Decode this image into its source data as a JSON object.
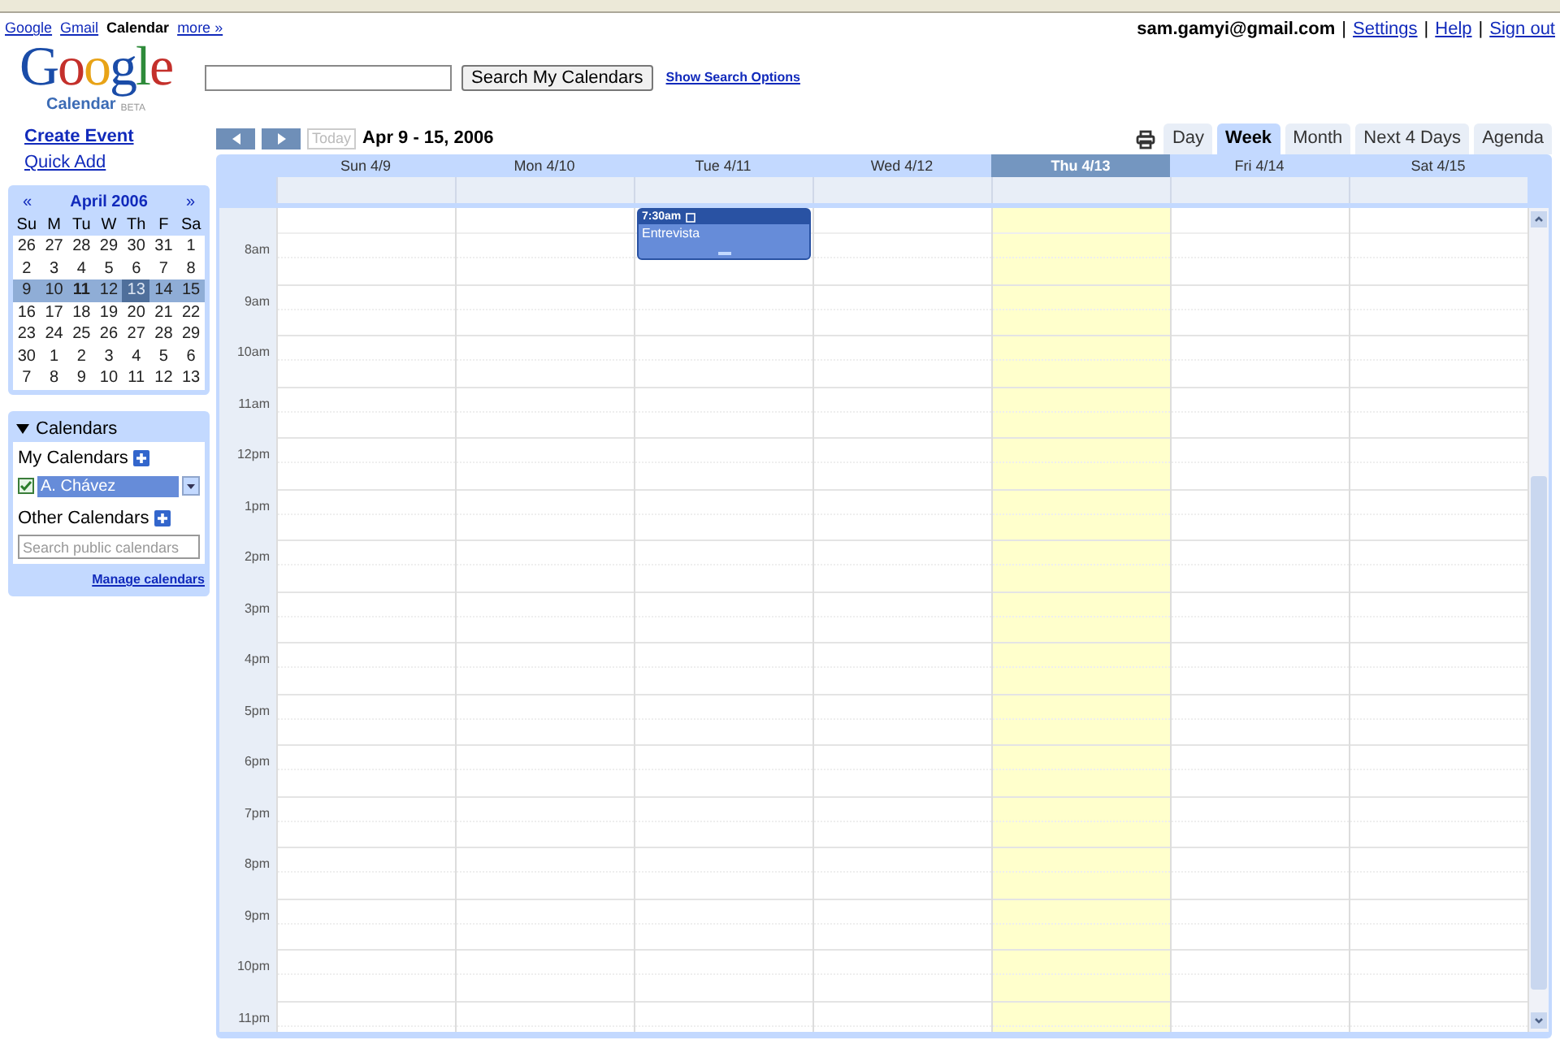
{
  "top_links": [
    {
      "label": "Google",
      "kind": "link"
    },
    {
      "label": "Gmail",
      "kind": "link"
    },
    {
      "label": "Calendar",
      "kind": "current"
    },
    {
      "label": "more »",
      "kind": "link"
    }
  ],
  "account": {
    "email": "sam.gamyi@gmail.com",
    "links": [
      {
        "separator": "|",
        "label": "Settings"
      },
      {
        "separator": "|",
        "label": "Help"
      },
      {
        "separator": "|",
        "label": "Sign out"
      }
    ]
  },
  "logo": {
    "word": "Google",
    "product": "Calendar",
    "badge": "BETA"
  },
  "search": {
    "button": "Search My Calendars",
    "options_link": "Show Search Options"
  },
  "sidebar": {
    "actions": [
      "Create Event",
      "Quick Add"
    ],
    "mini_calendar": {
      "title": "April 2006",
      "prev": "«",
      "next": "»",
      "weekdays": [
        "Su",
        "M",
        "Tu",
        "W",
        "Th",
        "F",
        "Sa"
      ],
      "weeks": [
        {
          "selected": false,
          "days": [
            {
              "label": "26",
              "today": false,
              "bold": false
            },
            {
              "label": "27",
              "today": false,
              "bold": false
            },
            {
              "label": "28",
              "today": false,
              "bold": false
            },
            {
              "label": "29",
              "today": false,
              "bold": false
            },
            {
              "label": "30",
              "today": false,
              "bold": false
            },
            {
              "label": "31",
              "today": false,
              "bold": false
            },
            {
              "label": "1",
              "today": false,
              "bold": false
            }
          ]
        },
        {
          "selected": false,
          "days": [
            {
              "label": "2",
              "today": false,
              "bold": false
            },
            {
              "label": "3",
              "today": false,
              "bold": false
            },
            {
              "label": "4",
              "today": false,
              "bold": false
            },
            {
              "label": "5",
              "today": false,
              "bold": false
            },
            {
              "label": "6",
              "today": false,
              "bold": false
            },
            {
              "label": "7",
              "today": false,
              "bold": false
            },
            {
              "label": "8",
              "today": false,
              "bold": false
            }
          ]
        },
        {
          "selected": true,
          "days": [
            {
              "label": "9",
              "today": false,
              "bold": false
            },
            {
              "label": "10",
              "today": false,
              "bold": false
            },
            {
              "label": "11",
              "today": false,
              "bold": true
            },
            {
              "label": "12",
              "today": false,
              "bold": false
            },
            {
              "label": "13",
              "today": true,
              "bold": false
            },
            {
              "label": "14",
              "today": false,
              "bold": false
            },
            {
              "label": "15",
              "today": false,
              "bold": false
            }
          ]
        },
        {
          "selected": false,
          "days": [
            {
              "label": "16",
              "today": false,
              "bold": false
            },
            {
              "label": "17",
              "today": false,
              "bold": false
            },
            {
              "label": "18",
              "today": false,
              "bold": false
            },
            {
              "label": "19",
              "today": false,
              "bold": false
            },
            {
              "label": "20",
              "today": false,
              "bold": false
            },
            {
              "label": "21",
              "today": false,
              "bold": false
            },
            {
              "label": "22",
              "today": false,
              "bold": false
            }
          ]
        },
        {
          "selected": false,
          "days": [
            {
              "label": "23",
              "today": false,
              "bold": false
            },
            {
              "label": "24",
              "today": false,
              "bold": false
            },
            {
              "label": "25",
              "today": false,
              "bold": false
            },
            {
              "label": "26",
              "today": false,
              "bold": false
            },
            {
              "label": "27",
              "today": false,
              "bold": false
            },
            {
              "label": "28",
              "today": false,
              "bold": false
            },
            {
              "label": "29",
              "today": false,
              "bold": false
            }
          ]
        },
        {
          "selected": false,
          "days": [
            {
              "label": "30",
              "today": false,
              "bold": false
            },
            {
              "label": "1",
              "today": false,
              "bold": false
            },
            {
              "label": "2",
              "today": false,
              "bold": false
            },
            {
              "label": "3",
              "today": false,
              "bold": false
            },
            {
              "label": "4",
              "today": false,
              "bold": false
            },
            {
              "label": "5",
              "today": false,
              "bold": false
            },
            {
              "label": "6",
              "today": false,
              "bold": false
            }
          ]
        },
        {
          "selected": false,
          "days": [
            {
              "label": "7",
              "today": false,
              "bold": false
            },
            {
              "label": "8",
              "today": false,
              "bold": false
            },
            {
              "label": "9",
              "today": false,
              "bold": false
            },
            {
              "label": "10",
              "today": false,
              "bold": false
            },
            {
              "label": "11",
              "today": false,
              "bold": false
            },
            {
              "label": "12",
              "today": false,
              "bold": false
            },
            {
              "label": "13",
              "today": false,
              "bold": false
            }
          ]
        }
      ]
    },
    "calendars": {
      "title": "Calendars",
      "expanded": true,
      "my_label": "My Calendars",
      "my": [
        {
          "name": "A. Chávez",
          "checked": true,
          "color": "#668cd9"
        }
      ],
      "other_label": "Other Calendars",
      "search_placeholder": "Search public calendars",
      "manage_link": "Manage calendars"
    }
  },
  "toolbar": {
    "today": "Today",
    "range": "Apr 9 - 15, 2006"
  },
  "views": [
    {
      "label": "Day",
      "selected": false
    },
    {
      "label": "Week",
      "selected": true
    },
    {
      "label": "Month",
      "selected": false
    },
    {
      "label": "Next 4 Days",
      "selected": false
    },
    {
      "label": "Agenda",
      "selected": false
    }
  ],
  "days": [
    {
      "label": "Sun 4/9",
      "selected": false
    },
    {
      "label": "Mon 4/10",
      "selected": false
    },
    {
      "label": "Tue 4/11",
      "selected": false,
      "events": [
        {
          "time": "7:30am",
          "title": "Entrevista"
        }
      ]
    },
    {
      "label": "Wed 4/12",
      "selected": false
    },
    {
      "label": "Thu 4/13",
      "selected": true
    },
    {
      "label": "Fri 4/14",
      "selected": false
    },
    {
      "label": "Sat 4/15",
      "selected": false
    }
  ],
  "hours": [
    "8am",
    "9am",
    "10am",
    "11am",
    "12pm",
    "1pm",
    "2pm",
    "3pm",
    "4pm",
    "5pm",
    "6pm",
    "7pm",
    "8pm",
    "9pm",
    "10pm",
    "11pm"
  ]
}
